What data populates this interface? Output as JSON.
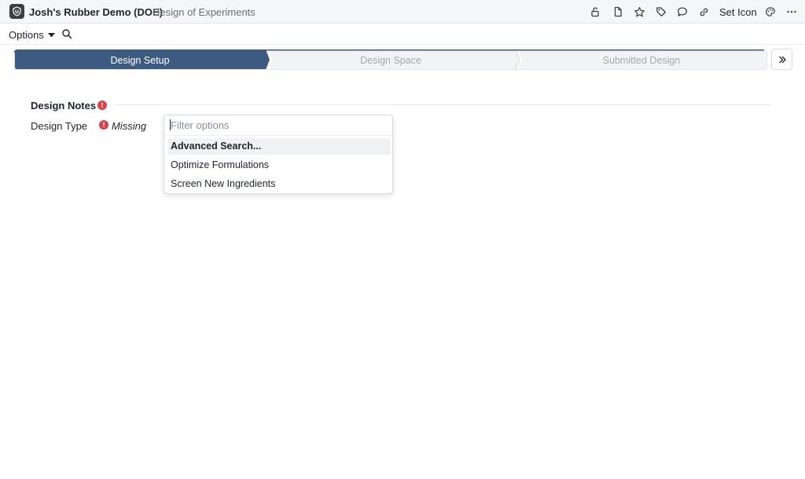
{
  "header": {
    "title": "Josh's Rubber Demo (DOE)",
    "subtitle": "Design of Experiments",
    "set_icon_label": "Set Icon",
    "icons": [
      "lock-open-icon",
      "document-icon",
      "star-icon",
      "tag-icon",
      "comment-icon",
      "link-icon",
      "palette-icon",
      "more-icon"
    ]
  },
  "toolbar": {
    "options_label": "Options"
  },
  "stepper": {
    "steps": [
      {
        "label": "Design Setup",
        "active": true
      },
      {
        "label": "Design Space",
        "active": false
      },
      {
        "label": "Submitted Design",
        "active": false
      }
    ],
    "active_color": "#3d5a80"
  },
  "section": {
    "title": "Design Notes"
  },
  "field": {
    "label": "Design Type",
    "status": "Missing"
  },
  "dropdown": {
    "placeholder": "Filter options",
    "options": [
      {
        "label": "Advanced Search...",
        "highlighted": true
      },
      {
        "label": "Optimize Formulations",
        "highlighted": false
      },
      {
        "label": "Screen New Ingredients",
        "highlighted": false
      }
    ]
  },
  "colors": {
    "error": "#d9434e",
    "accent": "#3d5a80"
  }
}
